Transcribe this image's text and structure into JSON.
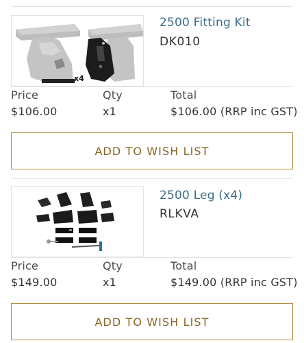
{
  "products": [
    {
      "name": "2500 Fitting Kit",
      "sku": "DK010",
      "image_caption": "x4",
      "price_label": "Price",
      "price": "$106.00",
      "qty_label": "Qty",
      "qty": "x1",
      "total_label": "Total",
      "total": "$106.00 (RRP inc GST)",
      "wish_label": "ADD TO WISH LIST"
    },
    {
      "name": "2500 Leg (x4)",
      "sku": "RLKVA",
      "price_label": "Price",
      "price": "$149.00",
      "qty_label": "Qty",
      "qty": "x1",
      "total_label": "Total",
      "total": "$149.00 (RRP inc GST)",
      "wish_label": "ADD TO WISH LIST"
    }
  ],
  "colors": {
    "link": "#3b6c8a",
    "button_border": "#b08a3c",
    "button_text": "#8a6420"
  }
}
